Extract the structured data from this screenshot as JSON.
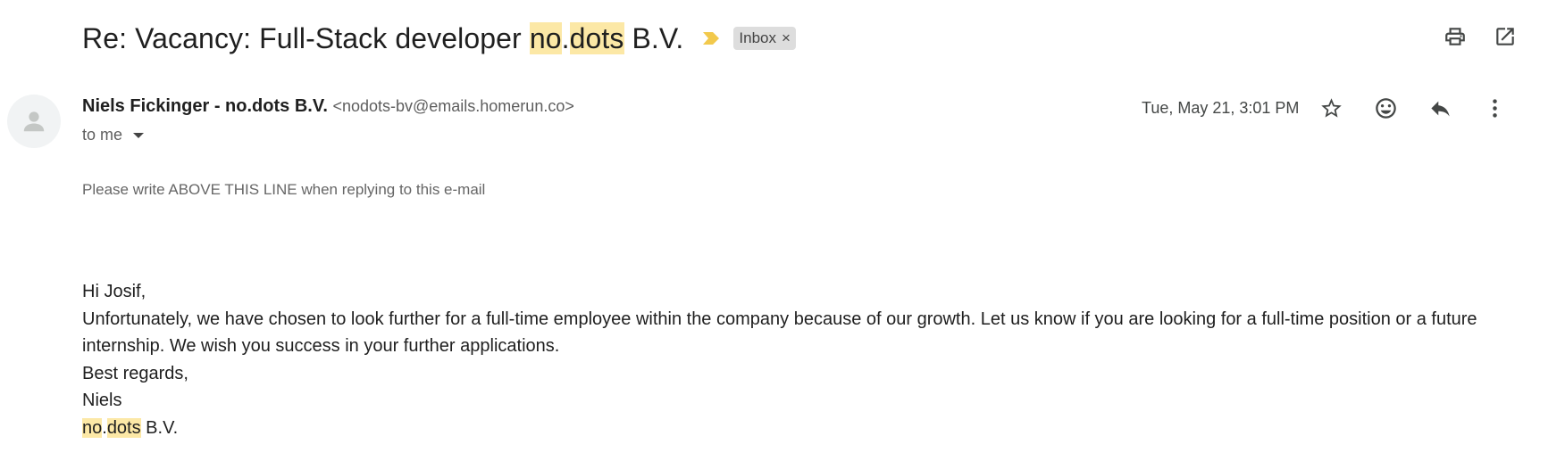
{
  "subject": {
    "part1": "Re: Vacancy: Full-Stack developer ",
    "hl1": "no",
    "dot": ".",
    "hl2": "dots",
    "part2": " B.V."
  },
  "label": {
    "text": "Inbox",
    "remove": "×"
  },
  "toolbar": {
    "print": "print-icon",
    "open_new_window": "open-in-new-icon"
  },
  "sender": {
    "name": "Niels Fickinger - no.dots B.V.",
    "email": "<nodots-bv@emails.homerun.co>",
    "to": "to me"
  },
  "date": "Tue, May 21, 3:01 PM",
  "message_actions": [
    "star-icon",
    "emoji-icon",
    "reply-icon",
    "more-vert-icon"
  ],
  "reply_notice": "Please write ABOVE THIS LINE when replying to this e-mail",
  "body": {
    "greeting": "Hi Josif,",
    "paragraph": "Unfortunately, we have chosen to look further for a full-time employee within the company because of our growth. Let us know if you are looking for a full-time position or a future internship. We wish you success in your further applications.",
    "closing": "Best regards,",
    "signature_name": "Niels",
    "signature_company": {
      "hl1": "no",
      "dot": ".",
      "hl2": "dots",
      "rest": " B.V."
    }
  },
  "colors": {
    "highlight": "#fce8a6",
    "importance": "#f2c94c",
    "chip": "#dddddd"
  }
}
